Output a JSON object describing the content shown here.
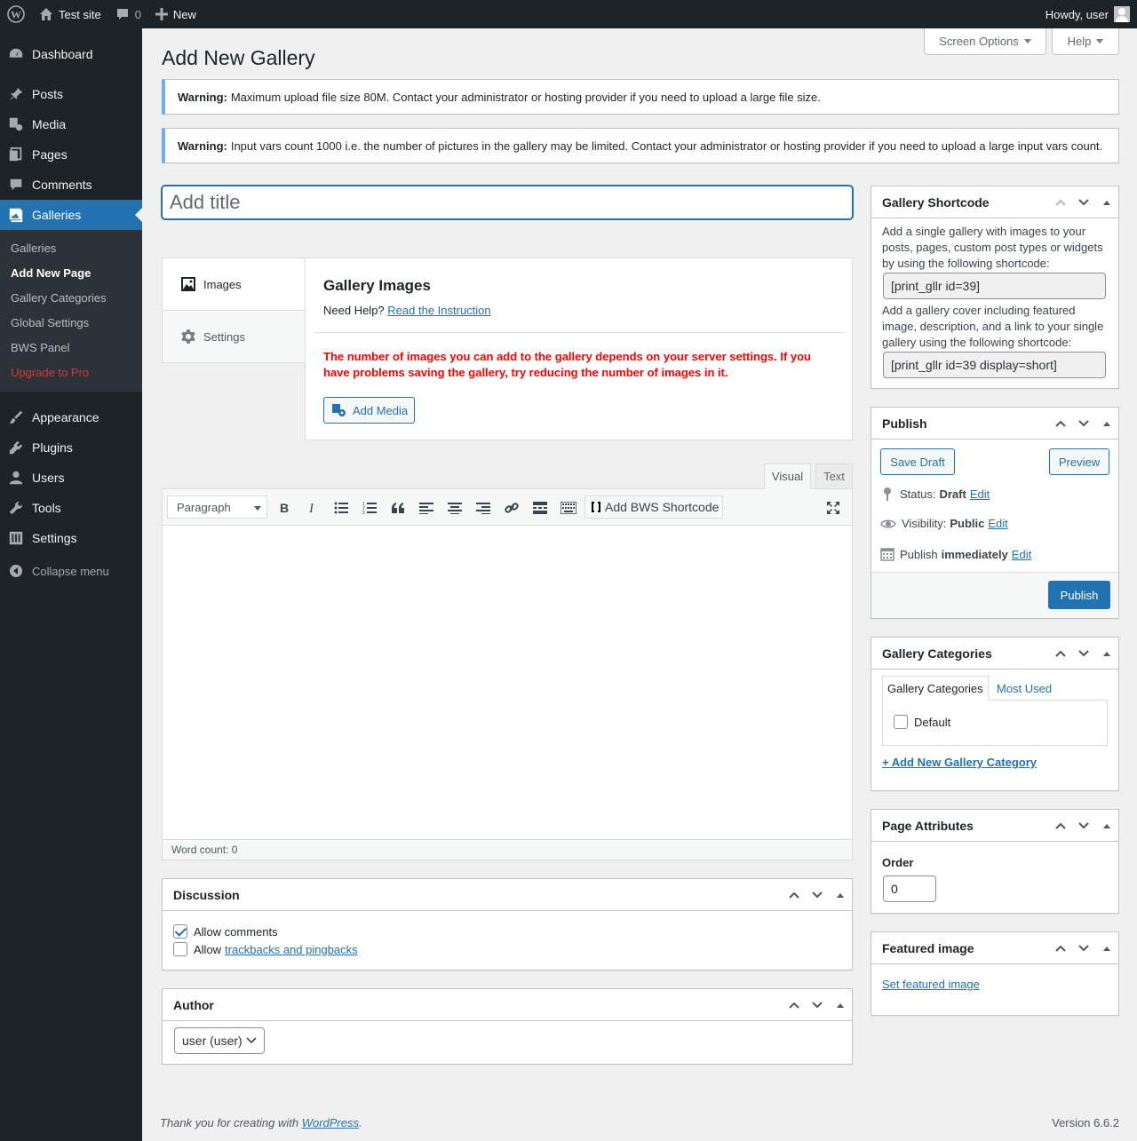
{
  "admin_bar": {
    "site_name": "Test site",
    "comments_count": "0",
    "new_label": "New",
    "howdy": "Howdy, user"
  },
  "sidebar": {
    "items": [
      {
        "label": "Dashboard",
        "icon": "dashboard-icon"
      },
      {
        "label": "Posts",
        "icon": "pin-icon"
      },
      {
        "label": "Media",
        "icon": "media-icon"
      },
      {
        "label": "Pages",
        "icon": "pages-icon"
      },
      {
        "label": "Comments",
        "icon": "comment-icon"
      },
      {
        "label": "Galleries",
        "icon": "gallery-icon"
      },
      {
        "label": "Appearance",
        "icon": "brush-icon"
      },
      {
        "label": "Plugins",
        "icon": "plugin-icon"
      },
      {
        "label": "Users",
        "icon": "user-icon"
      },
      {
        "label": "Tools",
        "icon": "wrench-icon"
      },
      {
        "label": "Settings",
        "icon": "settings-icon"
      }
    ],
    "submenu": [
      "Galleries",
      "Add New Page",
      "Gallery Categories",
      "Global Settings",
      "BWS Panel",
      "Upgrade to Pro"
    ],
    "collapse_label": "Collapse menu"
  },
  "screen_options": "Screen Options",
  "help": "Help",
  "page_title": "Add New Gallery",
  "notices": [
    {
      "strong": "Warning:",
      "text": "Maximum upload file size 80M. Contact your administrator or hosting provider if you need to upload a large file size."
    },
    {
      "strong": "Warning:",
      "text": "Input vars count 1000 i.e. the number of pictures in the gallery may be limited. Contact your administrator or hosting provider if you need to upload a large input vars count."
    }
  ],
  "title_placeholder": "Add title",
  "gallery": {
    "tabs": [
      "Images",
      "Settings"
    ],
    "heading": "Gallery Images",
    "need_help": "Need Help?",
    "instruction_link": "Read the Instruction",
    "warning": "The number of images you can add to the gallery depends on your server settings. If you have problems saving the gallery, try reducing the number of images in it.",
    "add_media": "Add Media"
  },
  "editor": {
    "tabs": [
      "Visual",
      "Text"
    ],
    "format": "Paragraph",
    "bws_shortcode": "Add BWS Shortcode",
    "word_count": "Word count: 0"
  },
  "discussion": {
    "title": "Discussion",
    "allow_comments": "Allow comments",
    "allow_comments_checked": true,
    "allow_prefix": "Allow",
    "trackbacks_link": "trackbacks and pingbacks",
    "trackbacks_checked": false
  },
  "author": {
    "title": "Author",
    "selected": "user (user)"
  },
  "shortcode_box": {
    "title": "Gallery Shortcode",
    "text1": "Add a single gallery with images to your posts, pages, custom post types or widgets by using the following shortcode:",
    "code1": "[print_gllr id=39]",
    "text2": "Add a gallery cover including featured image, description, and a link to your single gallery using the following shortcode:",
    "code2": "[print_gllr id=39 display=short]"
  },
  "publish": {
    "title": "Publish",
    "save_draft": "Save Draft",
    "preview": "Preview",
    "status_label": "Status:",
    "status_value": "Draft",
    "visibility_label": "Visibility:",
    "visibility_value": "Public",
    "publish_label": "Publish",
    "publish_value": "immediately",
    "edit": "Edit",
    "publish_button": "Publish"
  },
  "categories": {
    "title": "Gallery Categories",
    "tab_all": "Gallery Categories",
    "tab_most_used": "Most Used",
    "item": "Default",
    "item_checked": false,
    "add_new": "+ Add New Gallery Category"
  },
  "page_attributes": {
    "title": "Page Attributes",
    "order_label": "Order",
    "order_value": "0"
  },
  "featured_image": {
    "title": "Featured image",
    "set_link": "Set featured image"
  },
  "footer": {
    "thanks": "Thank you for creating with",
    "wp_link": "WordPress",
    "version": "Version 6.6.2"
  }
}
